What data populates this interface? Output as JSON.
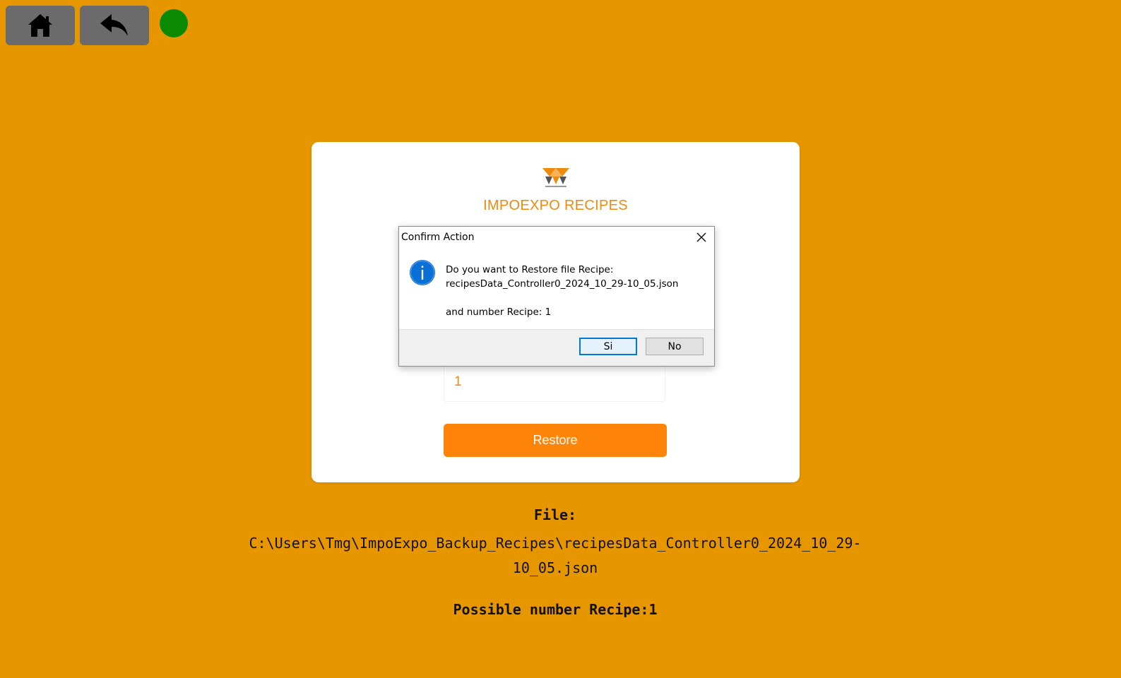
{
  "toolbar": {
    "home_icon": "home-icon",
    "back_icon": "reply-arrow-icon",
    "status_color": "#0a8a00"
  },
  "card": {
    "title": "IMPOEXPO RECIPES",
    "recipe_number_value": "1",
    "restore_label": "Restore",
    "accent_color": "#ff840a"
  },
  "file_info": {
    "label": "File:",
    "path_line1": "C:\\Users\\Tmg\\ImpoExpo_Backup_Recipes\\recipesData_Controller0_2024_10_29-",
    "path_line2": "10_05.json",
    "possible_number": "Possible number Recipe:1"
  },
  "dialog": {
    "title": "Confirm Action",
    "icon": "info-icon",
    "message_line1": "Do you want to Restore file Recipe:",
    "message_line2": "recipesData_Controller0_2024_10_29-10_05.json",
    "message_line3": "and number Recipe: 1",
    "yes_label": "Si",
    "no_label": "No"
  }
}
